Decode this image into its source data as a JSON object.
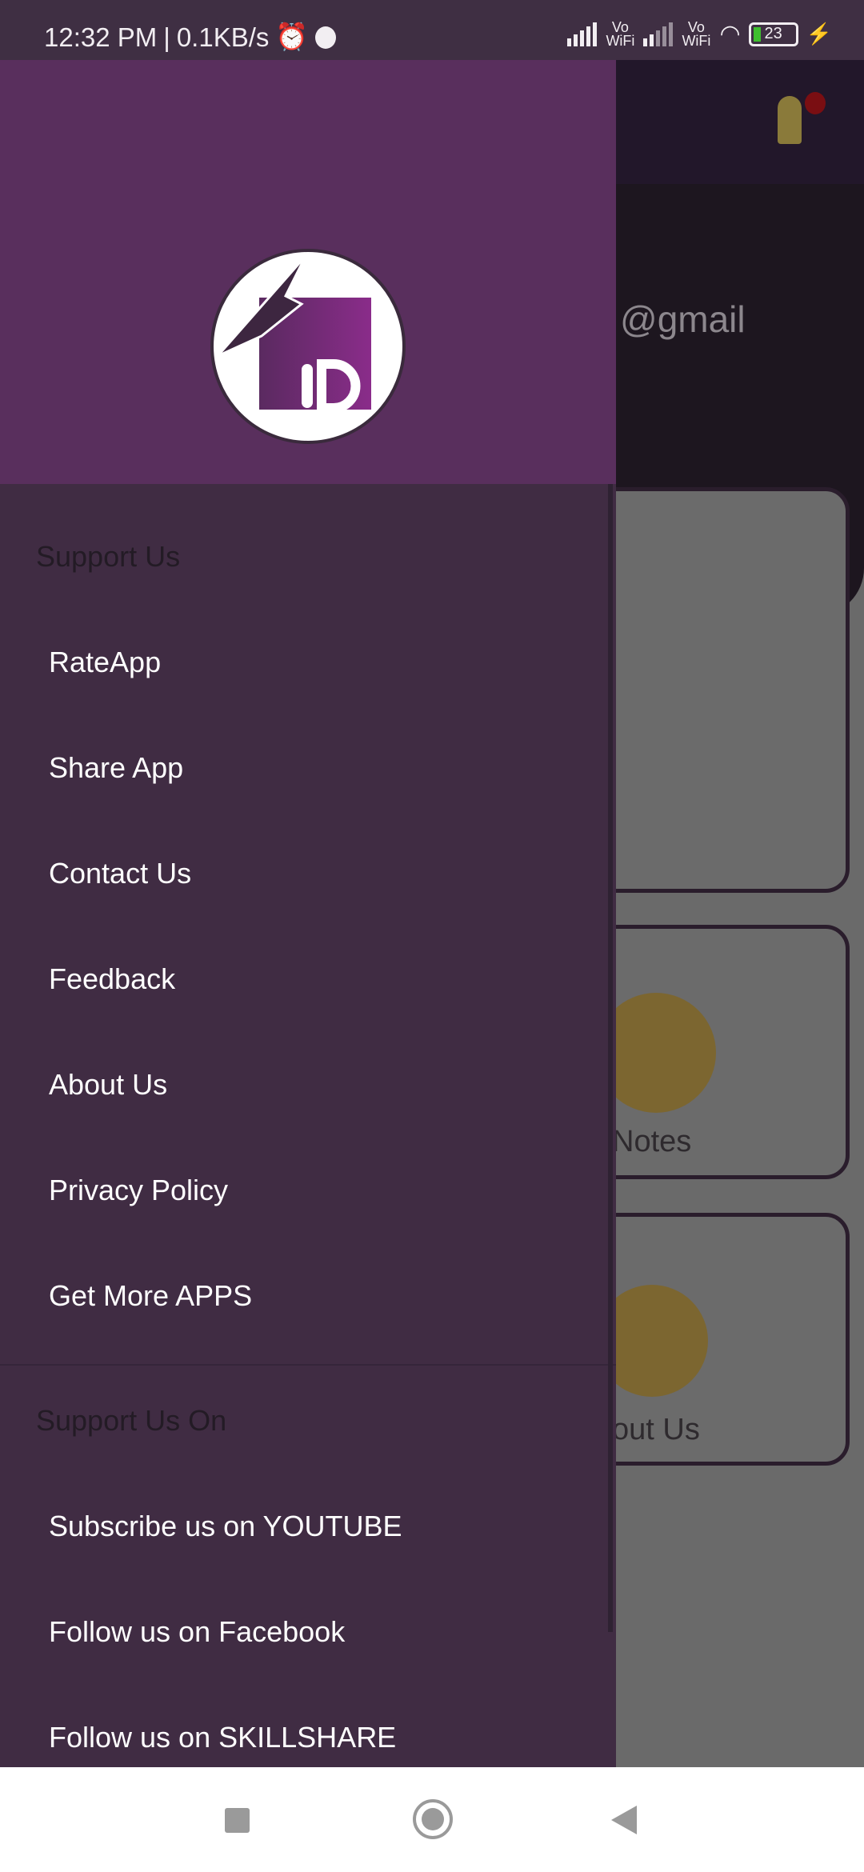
{
  "status_bar": {
    "time": "12:32 PM",
    "separator": "|",
    "net_speed": "0.1KB/s",
    "vowifi_1": "Vo WiFi",
    "vowifi_2": "Vo WiFi",
    "battery": "23",
    "icons": [
      "alarm-icon",
      "app-icon",
      "signal-icon",
      "wifi-icon",
      "battery-icon",
      "charging-icon"
    ]
  },
  "background": {
    "email_fragment": "@gmail",
    "card_notes": "Notes",
    "card_about": "out Us"
  },
  "drawer": {
    "section1": {
      "title": "Support Us",
      "items": [
        "RateApp",
        "Share App",
        "Contact Us",
        "Feedback",
        "About Us",
        "Privacy Policy",
        "Get More APPS"
      ]
    },
    "section2": {
      "title": "Support Us On",
      "items": [
        "Subscribe us on YOUTUBE",
        "Follow us on Facebook",
        "Follow us on SKILLSHARE"
      ]
    },
    "logo_text": "ID"
  },
  "colors": {
    "drawer_header": "#592f5d",
    "drawer_body": "#402c43",
    "bell": "#8a7a3a"
  }
}
